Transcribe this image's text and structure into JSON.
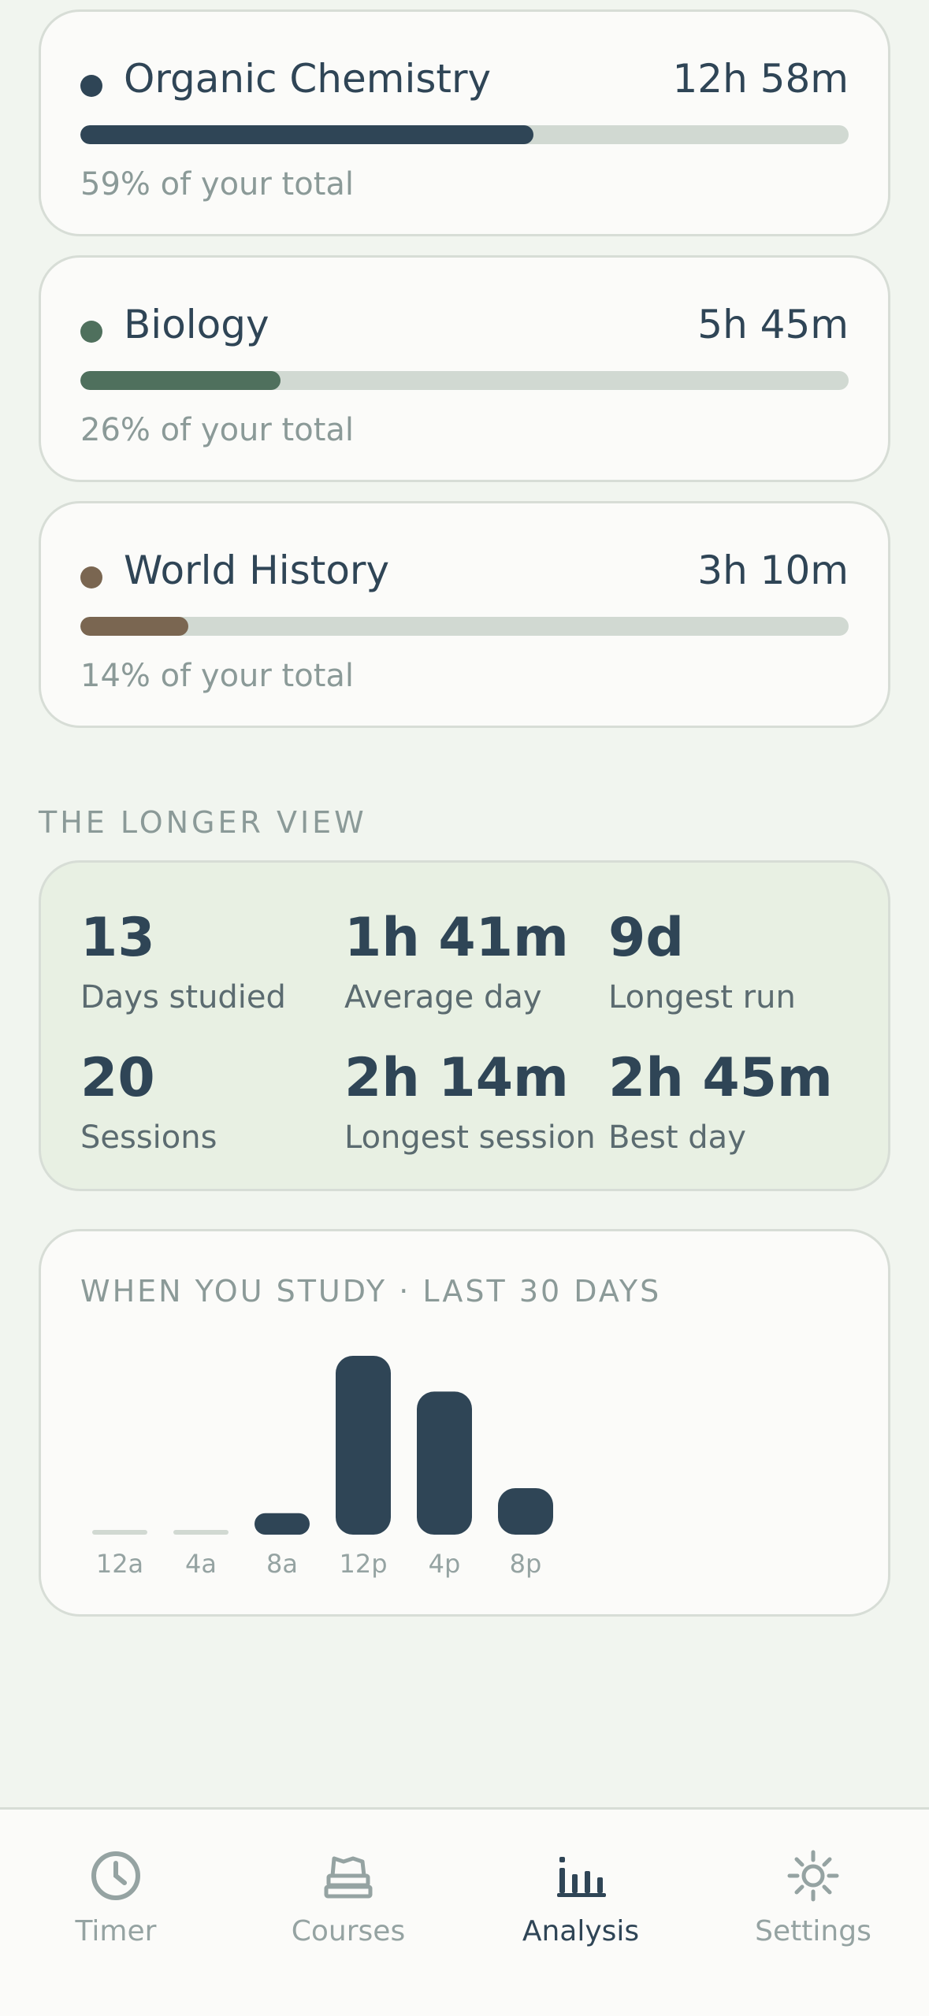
{
  "courses": [
    {
      "name": "Organic Chemistry",
      "duration": "12h 58m",
      "percent_label": "59% of your total",
      "share": 0.59,
      "color": "#2f4556"
    },
    {
      "name": "Biology",
      "duration": "5h 45m",
      "percent_label": "26% of your total",
      "share": 0.26,
      "color": "#4f705d"
    },
    {
      "name": "World History",
      "duration": "3h 10m",
      "percent_label": "14% of your total",
      "share": 0.14,
      "color": "#7a6651"
    }
  ],
  "longer_view": {
    "title": "THE LONGER VIEW",
    "stats": [
      {
        "value": "13",
        "label": "Days studied"
      },
      {
        "value": "1h 41m",
        "label": "Average day"
      },
      {
        "value": "9d",
        "label": "Longest run"
      },
      {
        "value": "20",
        "label": "Sessions"
      },
      {
        "value": "2h 14m",
        "label": "Longest session"
      },
      {
        "value": "2h 45m",
        "label": "Best day"
      }
    ]
  },
  "chart_data": {
    "type": "bar",
    "title": "WHEN YOU STUDY · LAST 30 DAYS",
    "categories": [
      "12a",
      "4a",
      "8a",
      "12p",
      "4p",
      "8p"
    ],
    "values": [
      0,
      0,
      12,
      100,
      80,
      26
    ],
    "ylim": [
      0,
      100
    ],
    "bar_color": "#2f4556",
    "empty_color": "#d1d9d2"
  },
  "tabs": [
    {
      "label": "Timer",
      "icon": "clock-icon",
      "active": false
    },
    {
      "label": "Courses",
      "icon": "books-icon",
      "active": false
    },
    {
      "label": "Analysis",
      "icon": "bar-chart-icon",
      "active": true
    },
    {
      "label": "Settings",
      "icon": "gear-icon",
      "active": false
    }
  ]
}
